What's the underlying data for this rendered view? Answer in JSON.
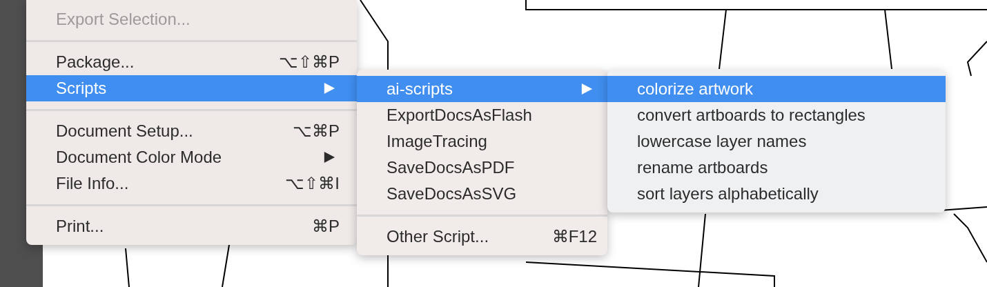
{
  "menus": [
    {
      "items": [
        {
          "kind": "item",
          "label": "Export Selection...",
          "disabled": true,
          "selected": false
        },
        {
          "kind": "separator"
        },
        {
          "kind": "item",
          "label": "Package...",
          "shortcut": "⌥⇧⌘P",
          "disabled": false,
          "selected": false
        },
        {
          "kind": "item",
          "label": "Scripts",
          "submenu": true,
          "disabled": false,
          "selected": true
        },
        {
          "kind": "separator"
        },
        {
          "kind": "item",
          "label": "Document Setup...",
          "shortcut": "⌥⌘P",
          "disabled": false,
          "selected": false
        },
        {
          "kind": "item",
          "label": "Document Color Mode",
          "submenu": true,
          "disabled": false,
          "selected": false
        },
        {
          "kind": "item",
          "label": "File Info...",
          "shortcut": "⌥⇧⌘I",
          "disabled": false,
          "selected": false
        },
        {
          "kind": "separator"
        },
        {
          "kind": "item",
          "label": "Print...",
          "shortcut": "⌘P",
          "disabled": false,
          "selected": false
        }
      ]
    },
    {
      "items": [
        {
          "kind": "item",
          "label": "ai-scripts",
          "submenu": true,
          "disabled": false,
          "selected": true
        },
        {
          "kind": "item",
          "label": "ExportDocsAsFlash",
          "disabled": false,
          "selected": false
        },
        {
          "kind": "item",
          "label": "ImageTracing",
          "disabled": false,
          "selected": false
        },
        {
          "kind": "item",
          "label": "SaveDocsAsPDF",
          "disabled": false,
          "selected": false
        },
        {
          "kind": "item",
          "label": "SaveDocsAsSVG",
          "disabled": false,
          "selected": false
        },
        {
          "kind": "separator"
        },
        {
          "kind": "item",
          "label": "Other Script...",
          "shortcut": "⌘F12",
          "disabled": false,
          "selected": false
        }
      ]
    },
    {
      "items": [
        {
          "kind": "item",
          "label": "colorize artwork",
          "disabled": false,
          "selected": true
        },
        {
          "kind": "item",
          "label": "convert artboards to rectangles",
          "disabled": false,
          "selected": false
        },
        {
          "kind": "item",
          "label": "lowercase layer names",
          "disabled": false,
          "selected": false
        },
        {
          "kind": "item",
          "label": "rename artboards",
          "disabled": false,
          "selected": false
        },
        {
          "kind": "item",
          "label": "sort layers alphabetically",
          "disabled": false,
          "selected": false
        }
      ]
    }
  ]
}
